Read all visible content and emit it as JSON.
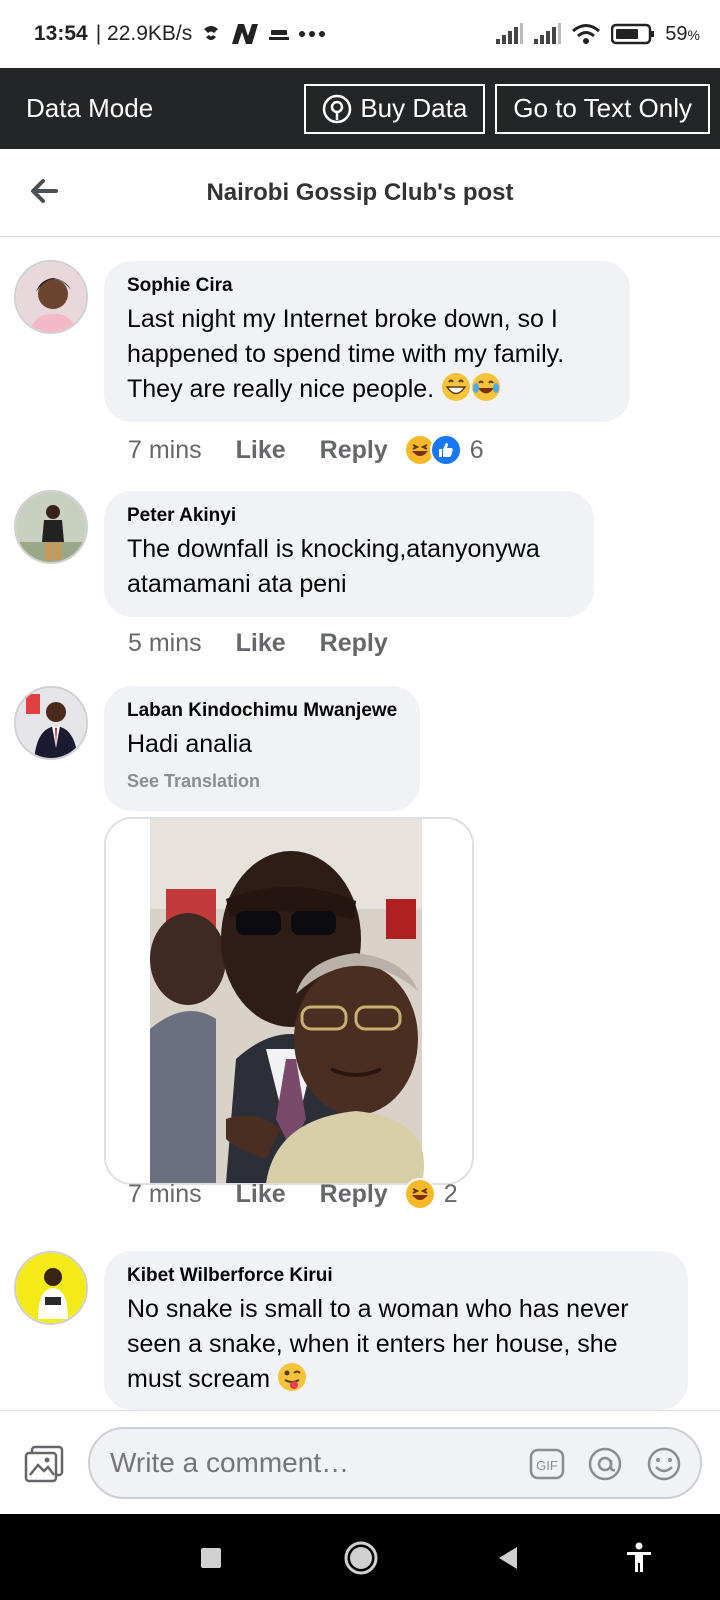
{
  "status_bar": {
    "time": "13:54",
    "speed": "| 22.9KB/s",
    "battery": "59",
    "battery_unit": "%"
  },
  "data_bar": {
    "mode_label": "Data Mode",
    "buy_label": "Buy Data",
    "text_only_label": "Go to Text Only"
  },
  "header": {
    "title": "Nairobi Gossip Club's post"
  },
  "comments": [
    {
      "author": "Sophie Cira",
      "text": "Last night my Internet broke down, so I happened to spend time with my family. They are really nice people.",
      "emojis": [
        "grinning-emoji",
        "laughing-emoji"
      ],
      "time": "7 mins",
      "like": "Like",
      "reply": "Reply",
      "reactions": [
        "haha-reaction",
        "like-reaction"
      ],
      "reaction_count": "6"
    },
    {
      "author": "Peter Akinyi",
      "text": "The downfall is knocking,atanyonywa atamamani ata peni",
      "time": "5 mins",
      "like": "Like",
      "reply": "Reply"
    },
    {
      "author": "Laban Kindochimu Mwanjewe",
      "text": "Hadi analia",
      "translate": "See Translation",
      "time": "7 mins",
      "like": "Like",
      "reply": "Reply",
      "reactions": [
        "haha-reaction"
      ],
      "reaction_count": "2"
    },
    {
      "author": "Kibet Wilberforce Kirui",
      "text": "No snake is small to a woman who has never seen a snake, when it enters her house, she must scream",
      "emojis": [
        "winking-tongue-emoji"
      ]
    }
  ],
  "composer": {
    "placeholder": "Write a comment…"
  },
  "colors": {
    "data_bar_bg": "#242526",
    "bubble_bg": "#f0f2f5",
    "like_blue": "#1877f2",
    "haha_yellow": "#f7b928"
  }
}
